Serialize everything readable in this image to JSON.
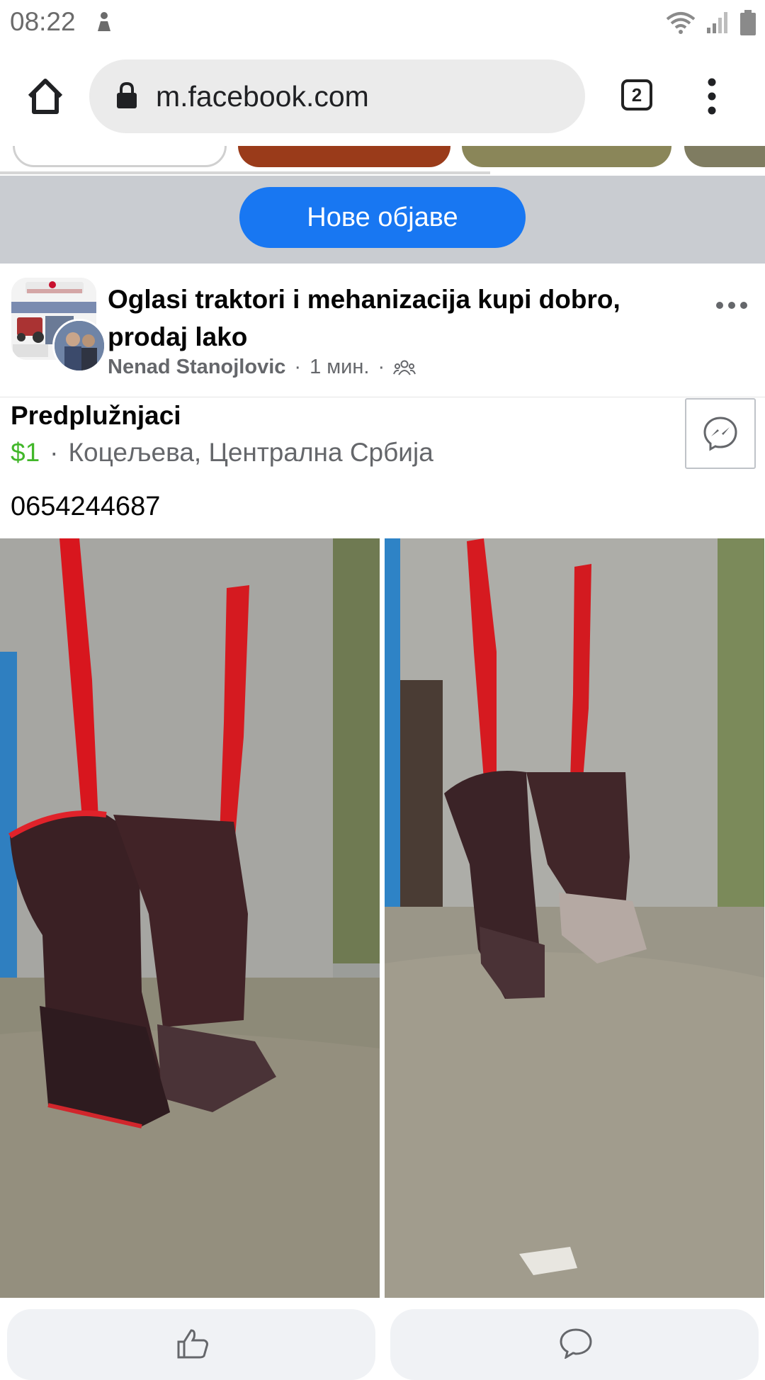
{
  "status_bar": {
    "time": "08:22"
  },
  "browser": {
    "url": "m.facebook.com",
    "tab_count": "2"
  },
  "feed": {
    "new_posts_label": "Нове објаве"
  },
  "post": {
    "group_name": "Oglasi traktori i mehanizacija kupi dobro, prodaj lako",
    "author": "Nenad Stanojlovic",
    "separator": "·",
    "time": "1 мин.",
    "audience_icon": "group-icon",
    "listing": {
      "title": "Predplužnjaci",
      "price": "$1",
      "location": "Коцељева, Централна Србија"
    },
    "text": "0654244687",
    "photos": [
      "photo-1",
      "photo-2"
    ]
  },
  "actions": {
    "like_icon": "thumbs-up-icon",
    "comment_icon": "comment-icon"
  },
  "colors": {
    "accent": "#1877f2",
    "price": "#42b72a",
    "secondary_text": "#65676b",
    "new_posts_bar": "#c9ccd1",
    "action_bg": "#f0f2f5"
  }
}
